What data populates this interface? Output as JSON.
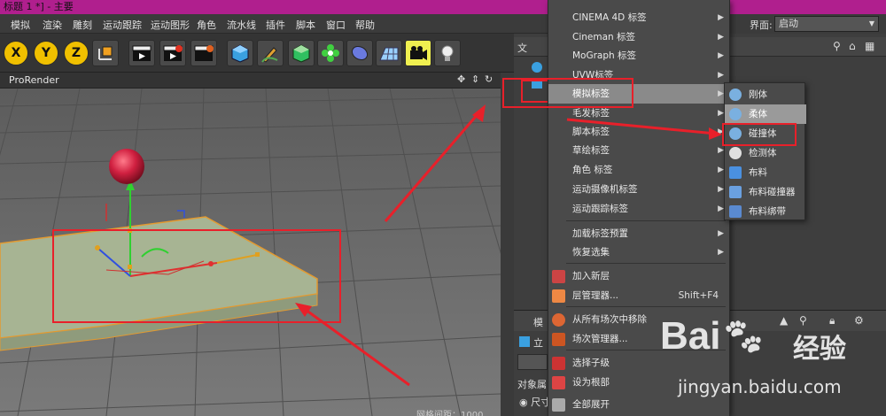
{
  "window": {
    "title": "标题 1 *] - 主要"
  },
  "menubar": {
    "items": [
      "模拟",
      "渲染",
      "雕刻",
      "运动跟踪",
      "运动图形",
      "角色",
      "流水线",
      "插件",
      "脚本",
      "窗口",
      "帮助"
    ]
  },
  "settings": {
    "label": "界面:",
    "value": "启动"
  },
  "toolbar": {
    "buttons": [
      "X",
      "Y",
      "Z"
    ]
  },
  "viewport": {
    "label": "ProRender"
  },
  "objects_panel": {
    "tab_label": "文",
    "bottom_tab": "模",
    "row1": "立",
    "attr_label": "对象属",
    "radio_label": "尺寸",
    "status": "网格间距：1000"
  },
  "context_menu": {
    "items": [
      {
        "label": "CINEMA 4D 标签",
        "arrow": "▶"
      },
      {
        "label": "Cineman 标签",
        "arrow": "▶"
      },
      {
        "label": "MoGraph 标签",
        "arrow": "▶"
      },
      {
        "label": "UVW标签",
        "arrow": "▶"
      },
      {
        "label": "模拟标签",
        "arrow": "▶"
      },
      {
        "label": "毛发标签",
        "arrow": "▶"
      },
      {
        "label": "脚本标签",
        "arrow": "▶"
      },
      {
        "label": "草绘标签",
        "arrow": "▶"
      },
      {
        "label": "角色 标签",
        "arrow": "▶"
      },
      {
        "label": "运动摄像机标签",
        "arrow": "▶"
      },
      {
        "label": "运动跟踪标签",
        "arrow": "▶"
      },
      {
        "label": "加载标签预置",
        "arrow": "▶"
      },
      {
        "label": "恢复选集",
        "arrow": "▶"
      },
      {
        "label": "加入新层",
        "arrow": ""
      },
      {
        "label": "层管理器...",
        "shortcut": "Shift+F4"
      },
      {
        "label": "从所有场次中移除",
        "arrow": ""
      },
      {
        "label": "场次管理器...",
        "arrow": ""
      },
      {
        "label": "选择子级",
        "arrow": ""
      },
      {
        "label": "设为根部",
        "arrow": ""
      },
      {
        "label": "全部展开",
        "arrow": ""
      }
    ]
  },
  "submenu": {
    "items": [
      "刚体",
      "柔体",
      "碰撞体",
      "检测体",
      "布料",
      "布料碰撞器",
      "布料绑带"
    ]
  },
  "watermark": {
    "brand": "Bai",
    "brand2": "经验",
    "url": "jingyan.baidu.com"
  },
  "colors": {
    "accent_red": "#e8202a",
    "title_magenta": "#b01f8e",
    "selected_grey": "#8a8a8a"
  }
}
